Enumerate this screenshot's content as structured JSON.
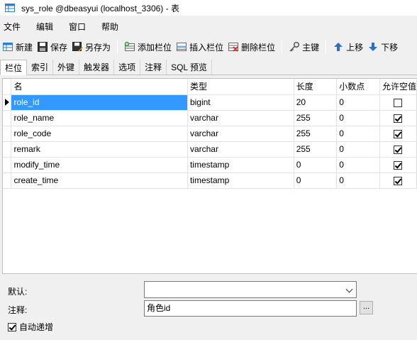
{
  "window": {
    "title": "sys_role @dbeasyui (localhost_3306) - 表"
  },
  "menu": {
    "items": [
      "文件",
      "编辑",
      "窗口",
      "帮助"
    ]
  },
  "toolbar": {
    "new_label": "新建",
    "save_label": "保存",
    "save_as_label": "另存为",
    "add_field_label": "添加栏位",
    "insert_field_label": "插入栏位",
    "delete_field_label": "删除栏位",
    "primary_key_label": "主键",
    "move_up_label": "上移",
    "move_down_label": "下移"
  },
  "tabs": [
    "栏位",
    "索引",
    "外键",
    "触发器",
    "选项",
    "注释",
    "SQL 预览"
  ],
  "grid": {
    "columns": [
      "名",
      "类型",
      "长度",
      "小数点",
      "允许空值"
    ],
    "rows": [
      {
        "name": "role_id",
        "type": "bigint",
        "length": "20",
        "decimals": "0",
        "allow_null": false,
        "selected": true
      },
      {
        "name": "role_name",
        "type": "varchar",
        "length": "255",
        "decimals": "0",
        "allow_null": true,
        "selected": false
      },
      {
        "name": "role_code",
        "type": "varchar",
        "length": "255",
        "decimals": "0",
        "allow_null": true,
        "selected": false
      },
      {
        "name": "remark",
        "type": "varchar",
        "length": "255",
        "decimals": "0",
        "allow_null": true,
        "selected": false
      },
      {
        "name": "modify_time",
        "type": "timestamp",
        "length": "0",
        "decimals": "0",
        "allow_null": true,
        "selected": false
      },
      {
        "name": "create_time",
        "type": "timestamp",
        "length": "0",
        "decimals": "0",
        "allow_null": true,
        "selected": false
      }
    ]
  },
  "properties": {
    "default_label": "默认:",
    "default_value": "",
    "comment_label": "注释:",
    "comment_value": "角色id",
    "ellipsis_label": "...",
    "auto_increment_label": "自动递增",
    "auto_increment_checked": true
  }
}
